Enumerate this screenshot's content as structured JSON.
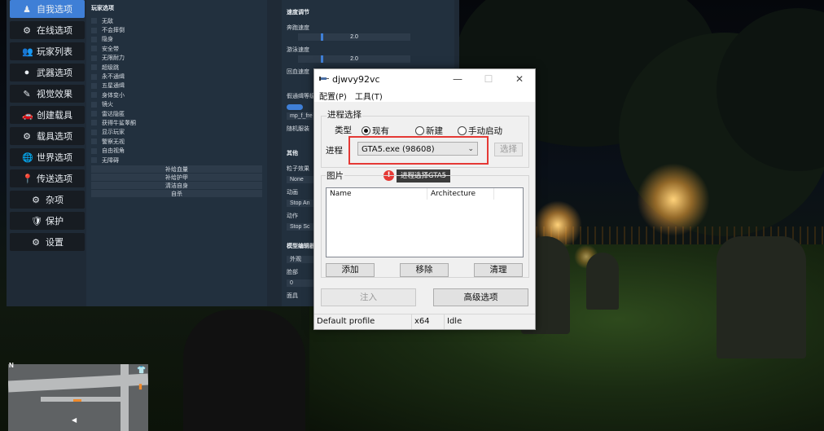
{
  "menu": [
    {
      "label": "自我选项",
      "icon": "♟",
      "icon_name": "person-icon",
      "active": true
    },
    {
      "label": "在线选项",
      "icon": "⚙",
      "icon_name": "online-icon"
    },
    {
      "label": "玩家列表",
      "icon": "👥",
      "icon_name": "players-icon"
    },
    {
      "label": "武器选项",
      "icon": "●",
      "icon_name": "bomb-icon"
    },
    {
      "label": "视觉效果",
      "icon": "✎",
      "icon_name": "visual-icon"
    },
    {
      "label": "创建载具",
      "icon": "🚗",
      "icon_name": "car-icon"
    },
    {
      "label": "载具选项",
      "icon": "⚙",
      "icon_name": "vehicle-gear-icon"
    },
    {
      "label": "世界选项",
      "icon": "🌐",
      "icon_name": "globe-icon"
    },
    {
      "label": "传送选项",
      "icon": "📍",
      "icon_name": "pin-icon"
    },
    {
      "label": "杂项",
      "icon": "⚙",
      "icon_name": "misc-icon"
    },
    {
      "label": "保护",
      "icon": "🛡",
      "icon_name": "shield-icon"
    },
    {
      "label": "设置",
      "icon": "⚙",
      "icon_name": "settings-icon"
    }
  ],
  "player_options": {
    "title": "玩家选项",
    "checkboxes": [
      "无敌",
      "不会摔倒",
      "隐身",
      "安全带",
      "无限耐力",
      "超级跳",
      "永不通缉",
      "五星通缉",
      "身体变小",
      "镜火",
      "雷达隐匿",
      "获得牛鲨睾酮",
      "显示玩家",
      "警察无视",
      "自由视角",
      "无障碍"
    ],
    "buttons": [
      "补给血量",
      "补给护甲",
      "清洁自身",
      "自杀"
    ]
  },
  "speed": {
    "title": "速度调节",
    "run_label": "奔跑速度",
    "run_value": "2.0",
    "swim_label": "游泳速度",
    "swim_value": "2.0",
    "regen_label": "回血速度",
    "wanted_label": "假通缉等级",
    "mp_field": "mp_f_fre",
    "random_label": "随机服装"
  },
  "other": {
    "title": "其他",
    "particle_label": "粒子效果",
    "particle_value": "None",
    "anim_label": "动画",
    "anim_button": "Stop An",
    "action_label": "动作",
    "action_button": "Stop Sc"
  },
  "model_editor": {
    "title": "模型编辑器",
    "appearance_btn": "外观",
    "face_label": "脸部",
    "face_value": "0",
    "head_label": "面具"
  },
  "injector": {
    "title": "djwvy92vc",
    "menus": [
      "配置(P)",
      "工具(T)"
    ],
    "process_select_label": "进程选择",
    "type_label": "类型",
    "radios": [
      {
        "label": "现有",
        "checked": true
      },
      {
        "label": "新建",
        "checked": false
      },
      {
        "label": "手动启动",
        "checked": false
      }
    ],
    "process_label": "进程",
    "process_value": "GTA5.exe (98608)",
    "select_button": "选择",
    "tooltip": "进程选择GTA5",
    "badge": "!",
    "images_label": "图片",
    "columns": [
      "Name",
      "Architecture"
    ],
    "add_button": "添加",
    "remove_button": "移除",
    "clear_button": "清理",
    "inject_button": "注入",
    "advanced_button": "高级选项",
    "status": [
      "Default profile",
      "x64",
      "Idle"
    ]
  },
  "minimap": {
    "compass": "N"
  },
  "colors": {
    "accent": "#3f7fd6",
    "highlight": "#e53935"
  }
}
